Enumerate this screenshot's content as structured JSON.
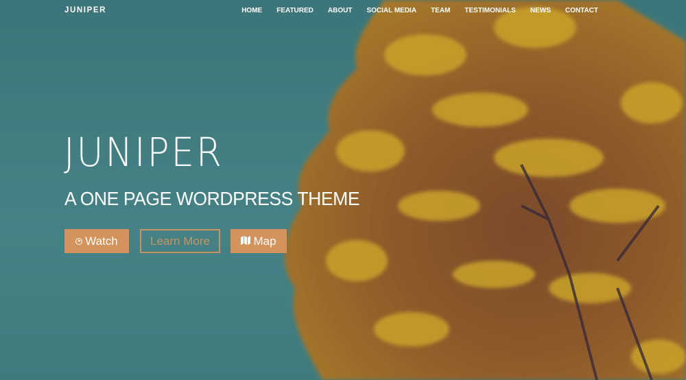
{
  "site": {
    "logo": "JUNIPER"
  },
  "nav": {
    "items": [
      {
        "label": "HOME"
      },
      {
        "label": "FEATURED"
      },
      {
        "label": "ABOUT"
      },
      {
        "label": "SOCIAL MEDIA"
      },
      {
        "label": "TEAM"
      },
      {
        "label": "TESTIMONIALS"
      },
      {
        "label": "NEWS"
      },
      {
        "label": "CONTACT"
      }
    ]
  },
  "hero": {
    "title": "JUNIPER",
    "subtitle": "A ONE PAGE WORDPRESS THEME",
    "buttons": {
      "watch": {
        "label": "Watch",
        "icon": "play-circle-icon"
      },
      "learn_more": {
        "label": "Learn More"
      },
      "map": {
        "label": "Map",
        "icon": "map-icon"
      }
    }
  },
  "colors": {
    "background": "#3f7a7e",
    "accent": "#d4935b",
    "text": "#ffffff"
  }
}
